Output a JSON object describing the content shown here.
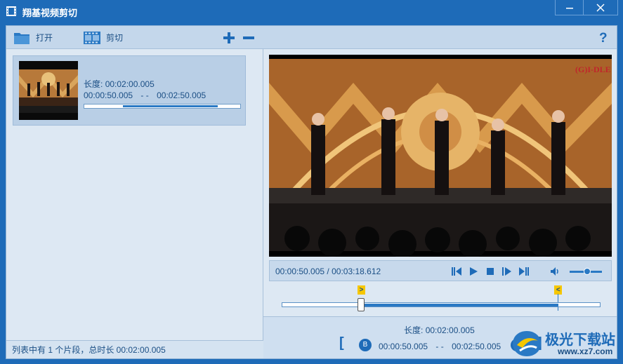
{
  "app": {
    "title": "翔基视频剪切"
  },
  "left": {
    "toolbar": {
      "open_label": "打开",
      "cut_label": "剪切"
    },
    "clip": {
      "length_label": "长度:",
      "length_value": "00:02:00.005",
      "start": "00:00:50.005",
      "separator": "- -",
      "end": "00:02:50.005"
    },
    "status": "列表中有 1 个片段，总时长 00:02:00.005"
  },
  "player": {
    "current_time": "00:00:50.005",
    "total_time": "00:03:18.612",
    "time_sep": " / ",
    "volume_level": 0.55,
    "overlay_brand": "(G)I-DLE"
  },
  "timeline": {
    "start_marker": ">",
    "end_marker": "<",
    "selection_start_fraction": 0.25,
    "selection_end_fraction": 0.87
  },
  "bottom": {
    "length_label": "长度:",
    "length_value": "00:02:00.005",
    "open_bracket": "[",
    "close_bracket": "]",
    "start_badge": "B",
    "start": "00:00:50.005",
    "separator": "- -",
    "end": "00:02:50.005"
  },
  "watermark": {
    "text": "极光下载站",
    "url": "www.xz7.com"
  },
  "colors": {
    "accent": "#1e6bb8",
    "marker": "#f6c700",
    "panel": "#dde8f3"
  }
}
